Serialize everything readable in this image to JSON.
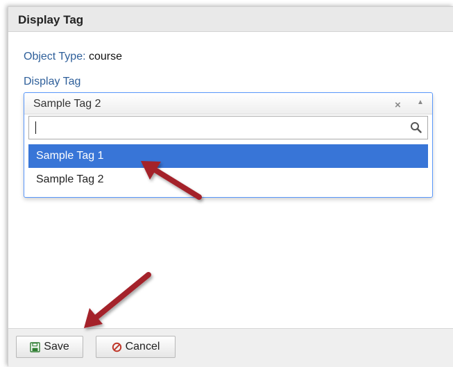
{
  "dialog": {
    "title": "Display Tag"
  },
  "form": {
    "object_type_label": "Object Type:",
    "object_type_value": "course",
    "display_tag_label": "Display Tag"
  },
  "select": {
    "selected_value": "Sample Tag 2",
    "clear_symbol": "×",
    "arrow_symbol": "▲",
    "search_value": "",
    "options": [
      {
        "label": "Sample Tag 1",
        "highlighted": true
      },
      {
        "label": "Sample Tag 2",
        "highlighted": false
      }
    ]
  },
  "footer": {
    "save_label": "Save",
    "cancel_label": "Cancel"
  },
  "icons": {
    "save": "floppy-disk-icon",
    "cancel": "prohibited-icon",
    "search": "magnifier-icon",
    "annotation": "red-arrow"
  },
  "colors": {
    "highlight": "#3875d7",
    "focus_border": "#5897fb",
    "annotation_arrow": "#a4202a",
    "label_blue": "#2e5f9a",
    "cancel_icon": "#c0392b",
    "save_icon": "#2f7d32"
  }
}
